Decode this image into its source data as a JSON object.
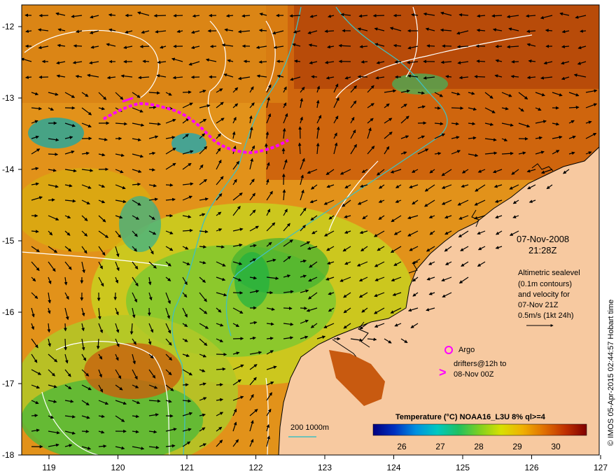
{
  "map": {
    "date": "07-Nov-2008",
    "time": "21:28Z",
    "altimetry_lines": [
      "Altimetric sealevel",
      "(0.1m contours)",
      "and velocity for",
      "07-Nov 21Z",
      "0.5m/s (1kt 24h)"
    ],
    "argo_label": "Argo",
    "drifters_lines": [
      "drifters@12h to",
      "08-Nov 00Z"
    ],
    "drifter_marker": ">",
    "depth_label": "200 1000m",
    "credit": "© IMOS 05-Apr-2015 02:44:57 Hobart time",
    "colorbar": {
      "title": "Temperature (°C) NOAA16_L3U 8% ql>=4",
      "ticks": [
        "26",
        "27",
        "28",
        "29",
        "30"
      ],
      "colors": [
        "#000080",
        "#0030c0",
        "#0090e0",
        "#00c8c0",
        "#20c060",
        "#80d020",
        "#d8e000",
        "#f0b000",
        "#e07000",
        "#c03000",
        "#800000"
      ]
    },
    "lon_ticks": [
      "119",
      "120",
      "121",
      "122",
      "123",
      "124",
      "125",
      "126",
      "127"
    ],
    "lat_ticks": [
      "-12",
      "-13",
      "-14",
      "-15",
      "-16",
      "-17",
      "-18"
    ],
    "colors": {
      "land": "#f7c9a0",
      "drifters": "#ff00ff",
      "bathymetry": "#40c0c0",
      "contours": "#ffffff"
    }
  }
}
